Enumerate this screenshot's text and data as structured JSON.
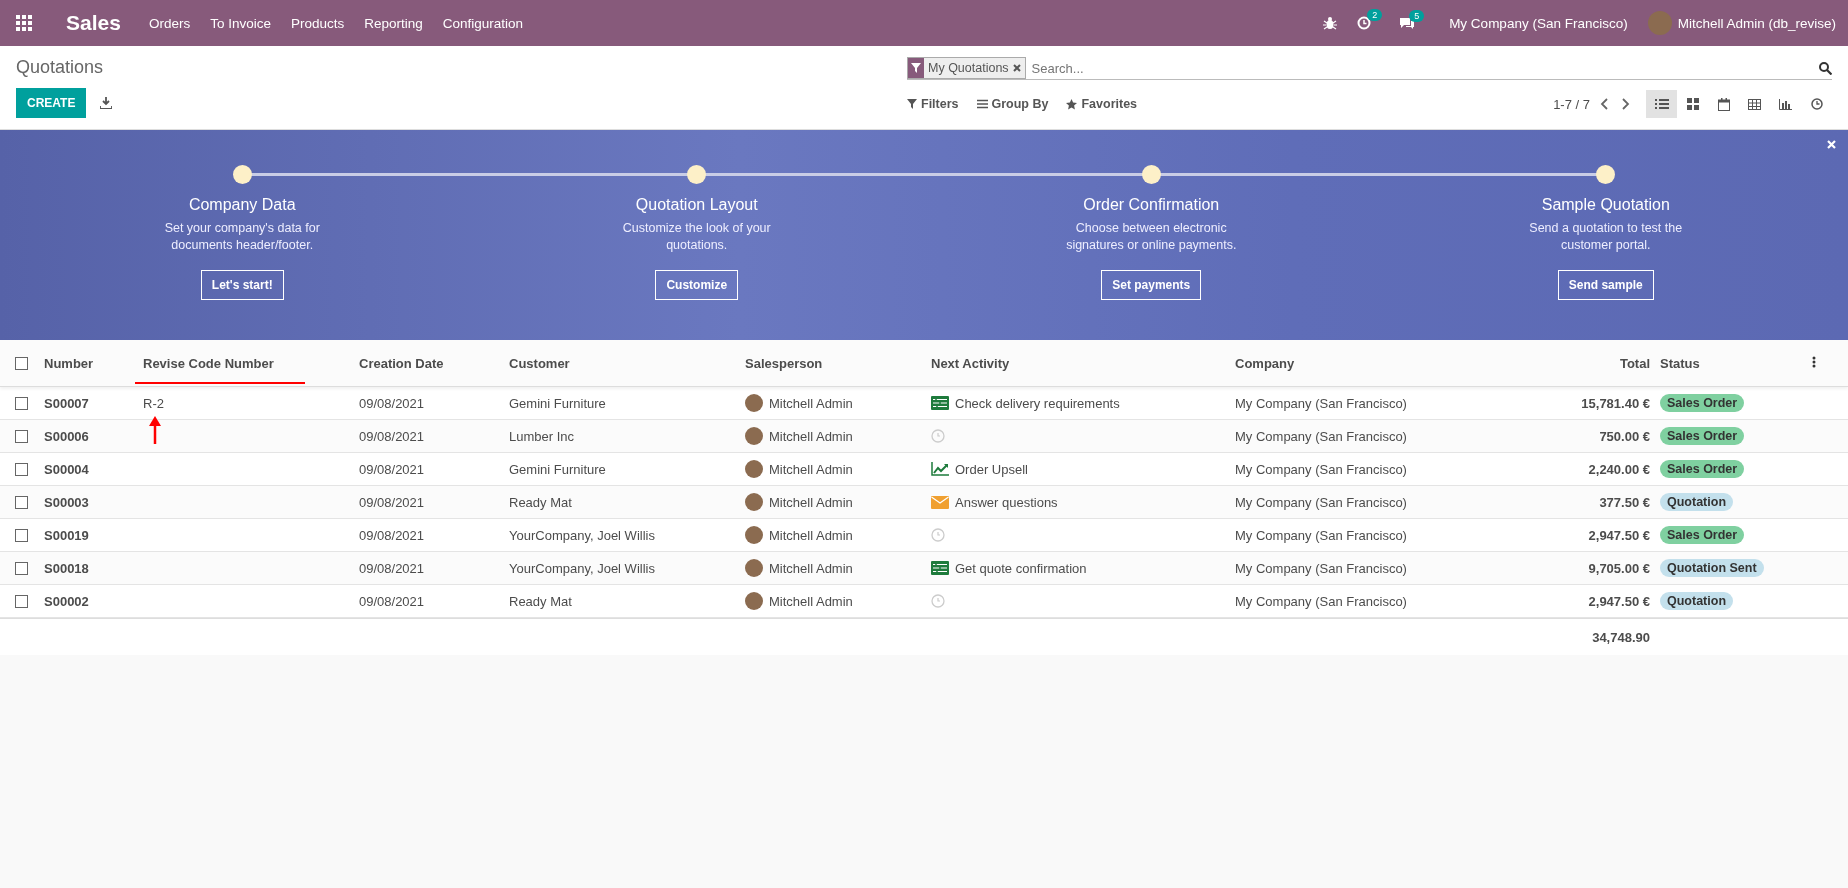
{
  "navbar": {
    "brand": "Sales",
    "menu": [
      "Orders",
      "To Invoice",
      "Products",
      "Reporting",
      "Configuration"
    ],
    "activity_count": "2",
    "message_count": "5",
    "company": "My Company (San Francisco)",
    "user": "Mitchell Admin (db_revise)"
  },
  "control_panel": {
    "breadcrumb": "Quotations",
    "create_label": "CREATE",
    "facet": "My Quotations",
    "search_placeholder": "Search...",
    "filters": "Filters",
    "group_by": "Group By",
    "favorites": "Favorites",
    "pager": "1-7 / 7",
    "views": [
      {
        "kind": "list",
        "selected": true
      },
      {
        "kind": "kanban",
        "selected": false
      },
      {
        "kind": "calendar",
        "selected": false
      },
      {
        "kind": "pivot",
        "selected": false
      },
      {
        "kind": "graph",
        "selected": false
      },
      {
        "kind": "activity",
        "selected": false
      }
    ]
  },
  "onboarding": {
    "steps": [
      {
        "title": "Company Data",
        "description": "Set your company's data for documents header/footer.",
        "button": "Let's start!"
      },
      {
        "title": "Quotation Layout",
        "description": "Customize the look of your quotations.",
        "button": "Customize"
      },
      {
        "title": "Order Confirmation",
        "description": "Choose between electronic signatures or online payments.",
        "button": "Set payments"
      },
      {
        "title": "Sample Quotation",
        "description": "Send a quotation to test the customer portal.",
        "button": "Send sample"
      }
    ]
  },
  "table": {
    "select_all_checked": false,
    "columns": [
      {
        "label": "Number",
        "annotated": false
      },
      {
        "label": "Revise Code Number",
        "annotated": true
      },
      {
        "label": "Creation Date",
        "annotated": false
      },
      {
        "label": "Customer",
        "annotated": false
      },
      {
        "label": "Salesperson",
        "annotated": false
      },
      {
        "label": "Next Activity",
        "annotated": false
      },
      {
        "label": "Company",
        "annotated": false
      },
      {
        "label": "Total",
        "annotated": false
      },
      {
        "label": "Status",
        "annotated": false
      }
    ],
    "rows": [
      {
        "checked": false,
        "number": "S00007",
        "revise_code": "R-2",
        "annotated": true,
        "date": "09/08/2021",
        "customer": "Gemini Furniture",
        "salesperson": "Mitchell Admin",
        "activity": {
          "kind": "todo",
          "label": "Check delivery requirements"
        },
        "company": "My Company (San Francisco)",
        "total": "15,781.40 €",
        "status": {
          "kind": "sale",
          "label": "Sales Order"
        }
      },
      {
        "checked": false,
        "number": "S00006",
        "annotated": false,
        "date": "09/08/2021",
        "customer": "Lumber Inc",
        "salesperson": "Mitchell Admin",
        "activity": {
          "kind": "none"
        },
        "company": "My Company (San Francisco)",
        "total": "750.00 €",
        "status": {
          "kind": "sale",
          "label": "Sales Order"
        }
      },
      {
        "checked": false,
        "number": "S00004",
        "annotated": false,
        "date": "09/08/2021",
        "customer": "Gemini Furniture",
        "salesperson": "Mitchell Admin",
        "activity": {
          "kind": "upsell",
          "label": "Order Upsell"
        },
        "company": "My Company (San Francisco)",
        "total": "2,240.00 €",
        "status": {
          "kind": "sale",
          "label": "Sales Order"
        }
      },
      {
        "checked": false,
        "number": "S00003",
        "annotated": false,
        "date": "09/08/2021",
        "customer": "Ready Mat",
        "salesperson": "Mitchell Admin",
        "activity": {
          "kind": "email",
          "label": "Answer questions"
        },
        "company": "My Company (San Francisco)",
        "total": "377.50 €",
        "status": {
          "kind": "quotation",
          "label": "Quotation"
        }
      },
      {
        "checked": false,
        "number": "S00019",
        "annotated": false,
        "date": "09/08/2021",
        "customer": "YourCompany, Joel Willis",
        "salesperson": "Mitchell Admin",
        "activity": {
          "kind": "none"
        },
        "company": "My Company (San Francisco)",
        "total": "2,947.50 €",
        "status": {
          "kind": "sale",
          "label": "Sales Order"
        }
      },
      {
        "checked": false,
        "number": "S00018",
        "annotated": false,
        "date": "09/08/2021",
        "customer": "YourCompany, Joel Willis",
        "salesperson": "Mitchell Admin",
        "activity": {
          "kind": "todo",
          "label": "Get quote confirmation"
        },
        "company": "My Company (San Francisco)",
        "total": "9,705.00 €",
        "status": {
          "kind": "sent",
          "label": "Quotation Sent"
        }
      },
      {
        "checked": false,
        "number": "S00002",
        "annotated": false,
        "date": "09/08/2021",
        "customer": "Ready Mat",
        "salesperson": "Mitchell Admin",
        "activity": {
          "kind": "none"
        },
        "company": "My Company (San Francisco)",
        "total": "2,947.50 €",
        "status": {
          "kind": "quotation",
          "label": "Quotation"
        }
      }
    ],
    "sum_total": "34,748.90"
  }
}
